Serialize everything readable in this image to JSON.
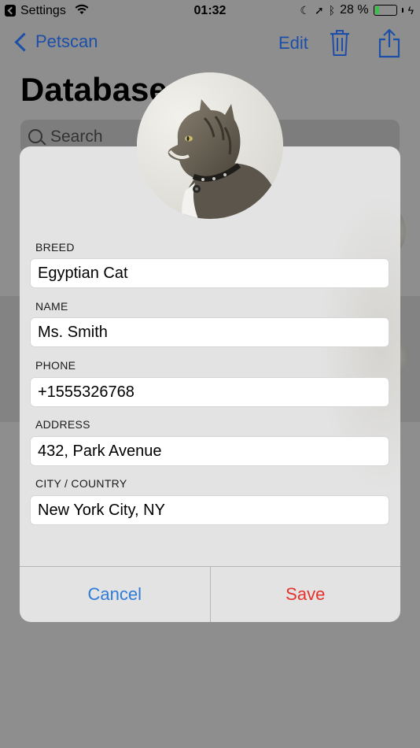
{
  "status": {
    "back_app": "Settings",
    "time": "01:32",
    "battery": "28 %",
    "battery_level": 0.28
  },
  "nav": {
    "back_label": "Petscan",
    "edit_label": "Edit"
  },
  "page": {
    "title": "Database",
    "search_placeholder": "Search"
  },
  "form": {
    "fields": [
      {
        "label": "BREED",
        "value": "Egyptian Cat"
      },
      {
        "label": "NAME",
        "value": "Ms. Smith"
      },
      {
        "label": "PHONE",
        "value": "+1555326768"
      },
      {
        "label": "ADDRESS",
        "value": "432, Park Avenue"
      },
      {
        "label": "CITY / COUNTRY",
        "value": "New York City, NY"
      }
    ],
    "cancel_label": "Cancel",
    "save_label": "Save"
  },
  "colors": {
    "accent": "#2f7bd8",
    "destructive": "#e5322b"
  }
}
